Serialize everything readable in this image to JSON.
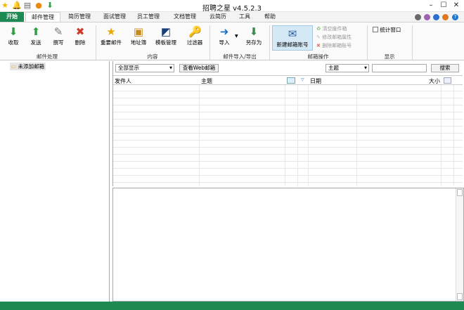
{
  "app_title": "招聘之星 v4.5.2.3",
  "tabs": [
    "开始",
    "邮件管理",
    "简历管理",
    "面试管理",
    "员工管理",
    "文档管理",
    "云简历",
    "工具",
    "帮助"
  ],
  "ribbon": {
    "receive": "收取",
    "send": "发送",
    "compose": "撰写",
    "delete": "删除",
    "group_mail": "邮件处理",
    "important": "重要邮件",
    "address_book": "地址簿",
    "template": "模板管理",
    "filter": "过滤器",
    "group_content": "内容",
    "import": "导入",
    "save_as": "另存为",
    "group_io": "邮件导入/导出",
    "new_account": "新建邮箱账号",
    "clear_trash": "清空废件箱",
    "modify_props": "修改邮箱属性",
    "delete_account": "删除邮箱账号",
    "group_mailbox": "邮箱操作",
    "stats_window": "统计窗口",
    "group_display": "显示"
  },
  "sidebar": {
    "root": "未添加邮箱"
  },
  "filter": {
    "view": "全部显示",
    "view_web": "查看Web邮箱",
    "field": "主题",
    "search": "搜索"
  },
  "table": {
    "headers": [
      "发件人",
      "主题",
      "日期",
      "大小"
    ]
  },
  "colors": {
    "accent": "#1e8a53"
  }
}
